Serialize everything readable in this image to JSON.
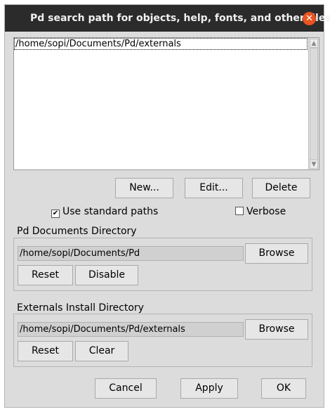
{
  "window": {
    "title": "Pd search path for objects, help, fonts, and other files"
  },
  "path_list": {
    "items": [
      "/home/sopi/Documents/Pd/externals"
    ]
  },
  "list_buttons": {
    "new": "New...",
    "edit": "Edit...",
    "delete": "Delete"
  },
  "options": {
    "use_standard_paths": {
      "label": "Use standard paths",
      "checked": true
    },
    "verbose": {
      "label": "Verbose",
      "checked": false
    }
  },
  "documents_group": {
    "label": "Pd Documents Directory",
    "path": "/home/sopi/Documents/Pd",
    "browse": "Browse",
    "reset": "Reset",
    "disable": "Disable"
  },
  "externals_group": {
    "label": "Externals Install Directory",
    "path": "/home/sopi/Documents/Pd/externals",
    "browse": "Browse",
    "reset": "Reset",
    "clear": "Clear"
  },
  "dialog_buttons": {
    "cancel": "Cancel",
    "apply": "Apply",
    "ok": "OK"
  }
}
